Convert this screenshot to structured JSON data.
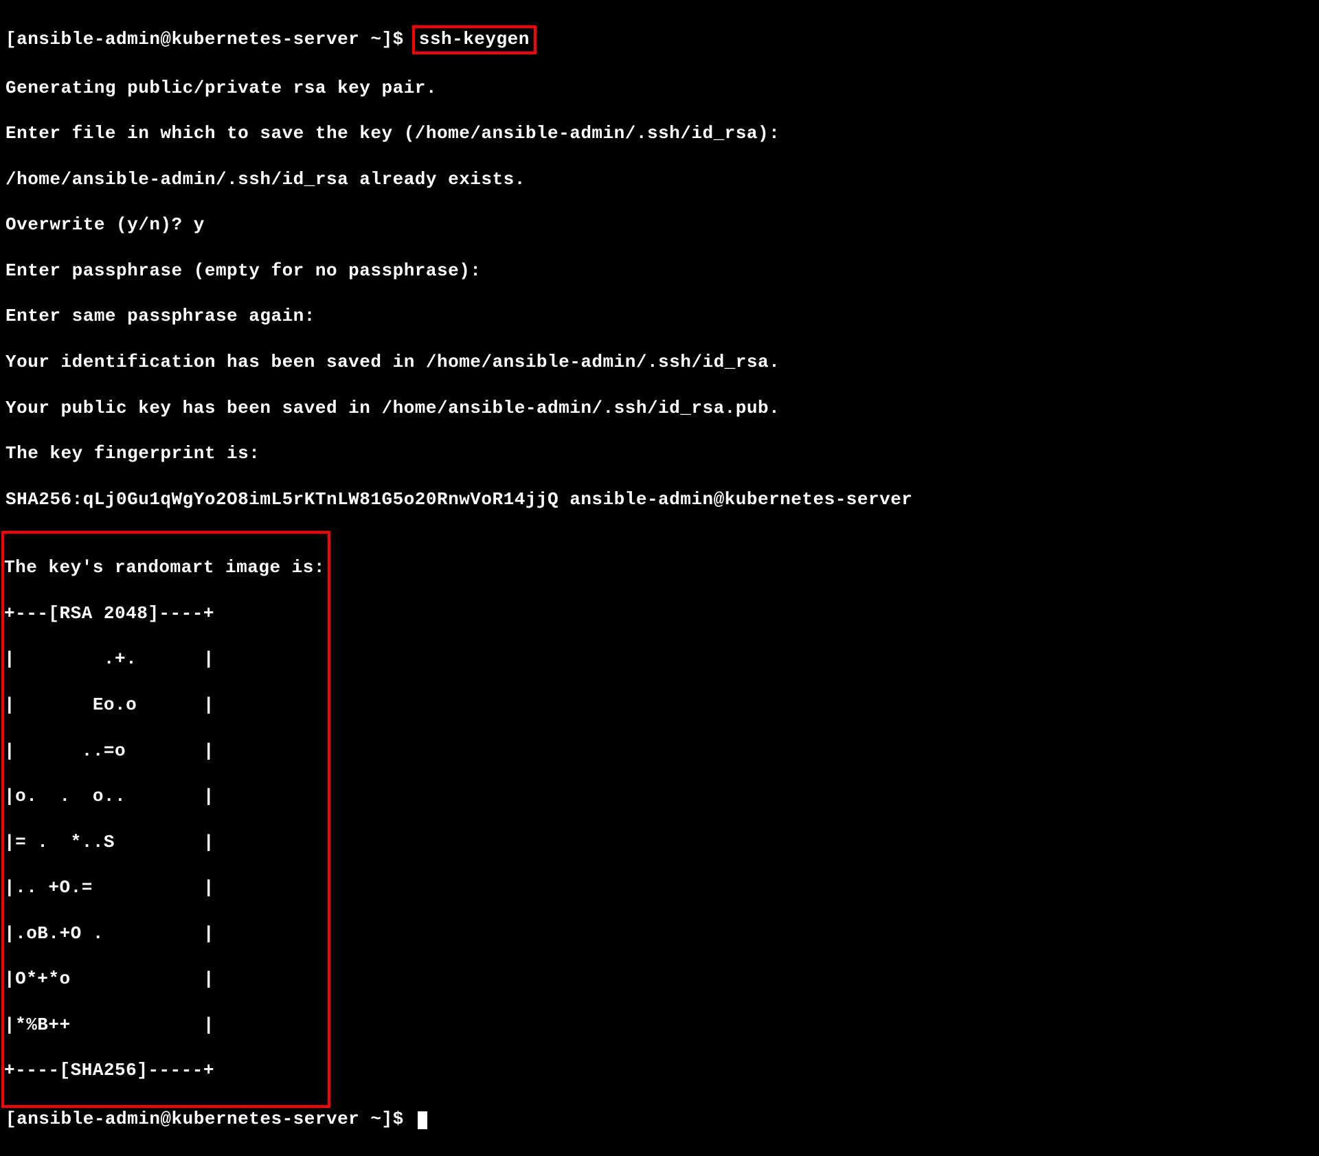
{
  "terminal": {
    "prompt1_prefix": "[ansible-admin@kubernetes-server ~]$ ",
    "command1": "ssh-keygen",
    "line2": "Generating public/private rsa key pair.",
    "line3": "Enter file in which to save the key (/home/ansible-admin/.ssh/id_rsa):",
    "line4": "/home/ansible-admin/.ssh/id_rsa already exists.",
    "line5": "Overwrite (y/n)? y",
    "line6": "Enter passphrase (empty for no passphrase):",
    "line7": "Enter same passphrase again:",
    "line8": "Your identification has been saved in /home/ansible-admin/.ssh/id_rsa.",
    "line9": "Your public key has been saved in /home/ansible-admin/.ssh/id_rsa.pub.",
    "line10": "The key fingerprint is:",
    "line11": "SHA256:qLj0Gu1qWgYo2O8imL5rKTnLW81G5o20RnwVoR14jjQ ansible-admin@kubernetes-server",
    "randomart": {
      "header": "The key's randomart image is:",
      "line1": "+---[RSA 2048]----+",
      "line2": "|        .+.      |",
      "line3": "|       Eo.o      |",
      "line4": "|      ..=o       |",
      "line5": "|o.  .  o..       |",
      "line6": "|= .  *..S        |",
      "line7": "|.. +O.=          |",
      "line8": "|.oB.+O .         |",
      "line9": "|O*+*o            |",
      "line10": "|*%B++            |",
      "line11": "+----[SHA256]-----+"
    },
    "prompt2": "[ansible-admin@kubernetes-server ~]$ "
  }
}
